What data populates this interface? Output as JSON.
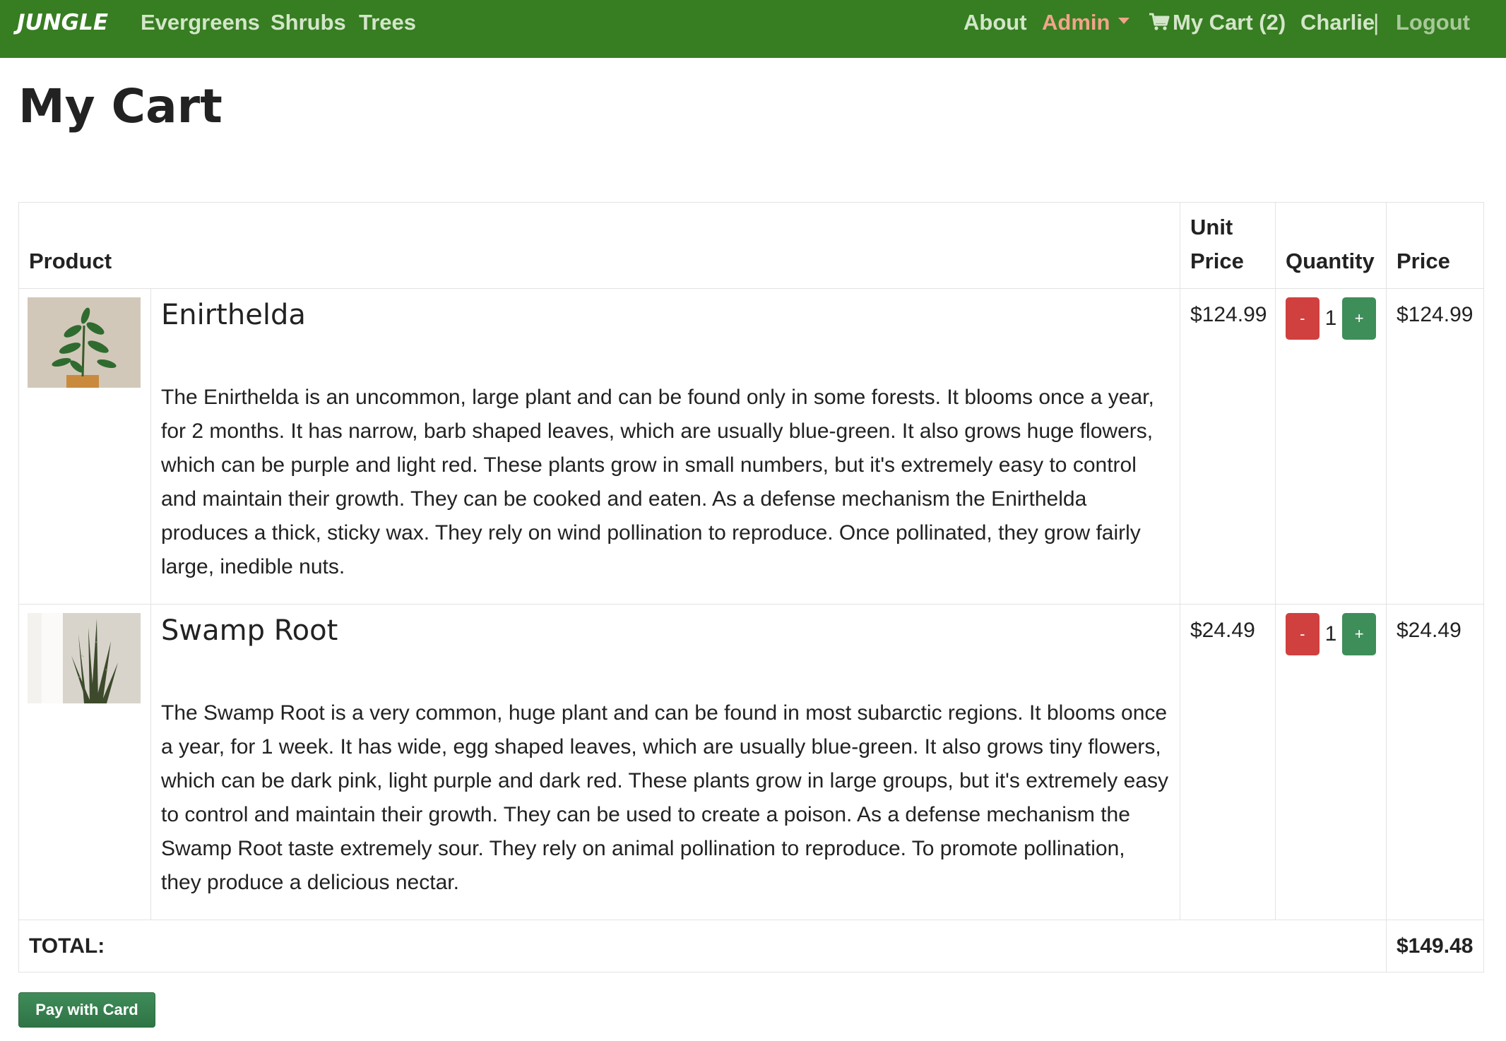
{
  "nav": {
    "brand": "JUNGLE",
    "links": [
      "Evergreens",
      "Shrubs",
      "Trees"
    ],
    "about": "About",
    "admin": "Admin",
    "cart": "My Cart (2)",
    "user": "Charlie",
    "separator": "|",
    "logout": "Logout",
    "colors": {
      "bar": "#377d22",
      "admin": "#f2a48a"
    }
  },
  "page": {
    "title": "My Cart"
  },
  "table": {
    "headers": {
      "product": "Product",
      "unit_price": "Unit Price",
      "quantity": "Quantity",
      "price": "Price"
    },
    "items": [
      {
        "name": "Enirthelda",
        "image": "plant-thumbnail-icon",
        "description": "The Enirthelda is an uncommon, large plant and can be found only in some forests. It blooms once a year, for 2 months. It has narrow, barb shaped leaves, which are usually blue-green. It also grows huge flowers, which can be purple and light red. These plants grow in small numbers, but it's extremely easy to control and maintain their growth. They can be cooked and eaten. As a defense mechanism the Enirthelda produces a thick, sticky wax. They rely on wind pollination to reproduce. Once pollinated, they grow fairly large, inedible nuts.",
        "unit_price": "$124.99",
        "quantity": "1",
        "price": "$124.99",
        "minus_label": "-",
        "plus_label": "+"
      },
      {
        "name": "Swamp Root",
        "image": "snake-plant-thumbnail-icon",
        "description": "The Swamp Root is a very common, huge plant and can be found in most subarctic regions. It blooms once a year, for 1 week. It has wide, egg shaped leaves, which are usually blue-green. It also grows tiny flowers, which can be dark pink, light purple and dark red. These plants grow in large groups, but it's extremely easy to control and maintain their growth. They can be used to create a poison. As a defense mechanism the Swamp Root taste extremely sour. They rely on animal pollination to reproduce. To promote pollination, they produce a delicious nectar.",
        "unit_price": "$24.49",
        "quantity": "1",
        "price": "$24.49",
        "minus_label": "-",
        "plus_label": "+"
      }
    ],
    "total_label": "TOTAL:",
    "total_value": "$149.48"
  },
  "pay_button": {
    "label": "Pay with Card"
  }
}
